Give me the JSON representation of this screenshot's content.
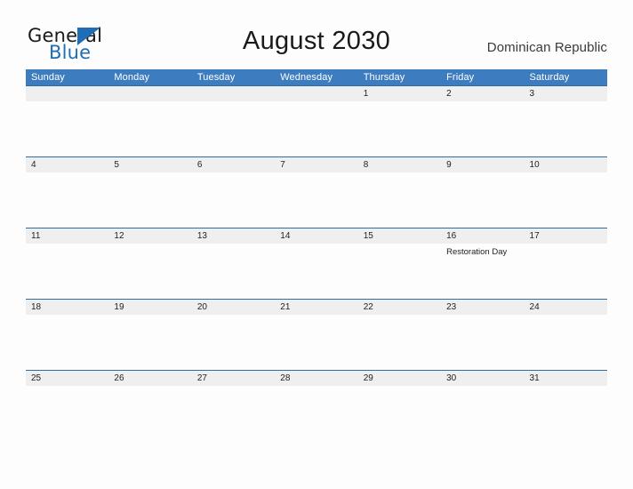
{
  "brand": {
    "word_one": "General",
    "word_two": "Blue",
    "triangle_icon": "triangle-icon",
    "accent_color": "#1f6db4"
  },
  "header": {
    "title": "August 2030",
    "region": "Dominican Republic"
  },
  "calendar": {
    "header_bg": "#3c7cbf",
    "date_band_bg": "#efefef",
    "date_band_border": "#2e6da4",
    "weekdays": [
      "Sunday",
      "Monday",
      "Tuesday",
      "Wednesday",
      "Thursday",
      "Friday",
      "Saturday"
    ],
    "weeks": [
      {
        "days": [
          {
            "date": "",
            "event": ""
          },
          {
            "date": "",
            "event": ""
          },
          {
            "date": "",
            "event": ""
          },
          {
            "date": "",
            "event": ""
          },
          {
            "date": "1",
            "event": ""
          },
          {
            "date": "2",
            "event": ""
          },
          {
            "date": "3",
            "event": ""
          }
        ]
      },
      {
        "days": [
          {
            "date": "4",
            "event": ""
          },
          {
            "date": "5",
            "event": ""
          },
          {
            "date": "6",
            "event": ""
          },
          {
            "date": "7",
            "event": ""
          },
          {
            "date": "8",
            "event": ""
          },
          {
            "date": "9",
            "event": ""
          },
          {
            "date": "10",
            "event": ""
          }
        ]
      },
      {
        "days": [
          {
            "date": "11",
            "event": ""
          },
          {
            "date": "12",
            "event": ""
          },
          {
            "date": "13",
            "event": ""
          },
          {
            "date": "14",
            "event": ""
          },
          {
            "date": "15",
            "event": ""
          },
          {
            "date": "16",
            "event": "Restoration Day"
          },
          {
            "date": "17",
            "event": ""
          }
        ]
      },
      {
        "days": [
          {
            "date": "18",
            "event": ""
          },
          {
            "date": "19",
            "event": ""
          },
          {
            "date": "20",
            "event": ""
          },
          {
            "date": "21",
            "event": ""
          },
          {
            "date": "22",
            "event": ""
          },
          {
            "date": "23",
            "event": ""
          },
          {
            "date": "24",
            "event": ""
          }
        ]
      },
      {
        "days": [
          {
            "date": "25",
            "event": ""
          },
          {
            "date": "26",
            "event": ""
          },
          {
            "date": "27",
            "event": ""
          },
          {
            "date": "28",
            "event": ""
          },
          {
            "date": "29",
            "event": ""
          },
          {
            "date": "30",
            "event": ""
          },
          {
            "date": "31",
            "event": ""
          }
        ]
      }
    ]
  }
}
